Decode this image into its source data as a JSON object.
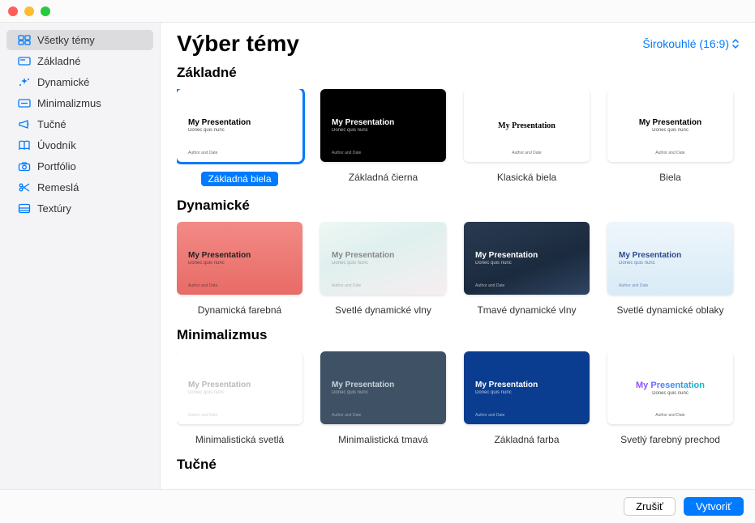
{
  "header": {
    "title": "Výber témy",
    "aspect": "Širokouhlé (16:9)"
  },
  "sidebar": {
    "items": [
      {
        "label": "Všetky témy",
        "icon": "grid",
        "selected": true
      },
      {
        "label": "Základné",
        "icon": "card"
      },
      {
        "label": "Dynamické",
        "icon": "sparkle"
      },
      {
        "label": "Minimalizmus",
        "icon": "line"
      },
      {
        "label": "Tučné",
        "icon": "megaphone"
      },
      {
        "label": "Úvodník",
        "icon": "book"
      },
      {
        "label": "Portfólio",
        "icon": "camera"
      },
      {
        "label": "Remeslá",
        "icon": "scissors"
      },
      {
        "label": "Textúry",
        "icon": "texture"
      }
    ]
  },
  "slide": {
    "title": "My Presentation",
    "subtitle": "Donec quis nunc",
    "author": "Author and Date"
  },
  "categories": [
    {
      "title": "Základné",
      "templates": [
        {
          "label": "Základná biela",
          "bg": "bg-white",
          "align": "left",
          "selected": true,
          "t": "dark",
          "subOn": true
        },
        {
          "label": "Základná čierna",
          "bg": "bg-black",
          "align": "left",
          "subOn": true
        },
        {
          "label": "Klasická biela",
          "bg": "bg-white",
          "align": "center",
          "t": "dark",
          "subOn": false,
          "serif": true
        },
        {
          "label": "Biela",
          "bg": "bg-white",
          "align": "center",
          "t": "dark",
          "subOn": true
        }
      ],
      "peek": "bg-white"
    },
    {
      "title": "Dynamické",
      "templates": [
        {
          "label": "Dynamická farebná",
          "bg": "bg-red",
          "align": "left",
          "subOn": true
        },
        {
          "label": "Svetlé dynamické vlny",
          "bg": "bg-lwave",
          "align": "left",
          "subOn": true
        },
        {
          "label": "Tmavé dynamické vlny",
          "bg": "bg-dwave",
          "align": "left",
          "subOn": true
        },
        {
          "label": "Svetlé dynamické oblaky",
          "bg": "bg-lcloud",
          "align": "left",
          "subOn": true
        }
      ],
      "peek": "bg-pinkpeek"
    },
    {
      "title": "Minimalizmus",
      "templates": [
        {
          "label": "Minimalistická svetlá",
          "bg": "bg-mlight",
          "align": "left",
          "subOn": true
        },
        {
          "label": "Minimalistická tmavá",
          "bg": "bg-mdark",
          "align": "left",
          "subOn": true
        },
        {
          "label": "Základná farba",
          "bg": "bg-mcolor",
          "align": "left",
          "subOn": true
        },
        {
          "label": "Svetlý farebný prechod",
          "bg": "bg-grad",
          "align": "center",
          "subOn": true
        }
      ],
      "peek": "bg-white"
    },
    {
      "title": "Tučné",
      "templates": [],
      "peek": ""
    }
  ],
  "footer": {
    "cancel": "Zrušiť",
    "create": "Vytvoriť"
  }
}
